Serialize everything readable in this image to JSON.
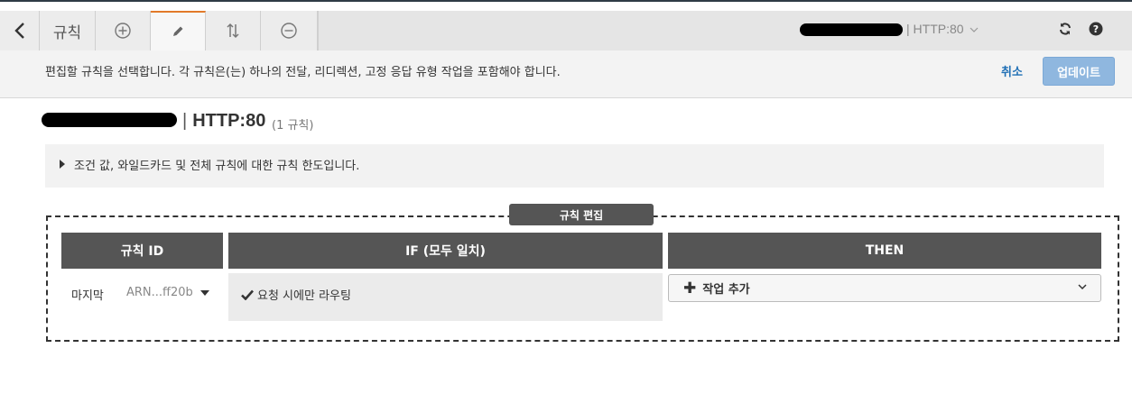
{
  "toolbar": {
    "tab_label": "규칙",
    "load_balancer_protocol": "| HTTP:80",
    "colors": {
      "active_accent": "#e27a2a"
    }
  },
  "infobar": {
    "message": "편집할 규칙을 선택합니다. 각 규칙은(는) 하나의 전달, 리디렉션, 고정 응답 유형 작업을 포함해야 합니다.",
    "cancel_label": "취소",
    "update_label": "업데이트"
  },
  "listener": {
    "title_suffix": "HTTP:80",
    "separator": "|",
    "rule_count": "(1 규칙)"
  },
  "conditions_toggle": {
    "label": "조건 값, 와일드카드 및 전체 규칙에 대한 규칙 한도입니다."
  },
  "edit_panel": {
    "label": "규칙 편집",
    "columns": [
      "규칙 ID",
      "IF (모두 일치)",
      "THEN"
    ],
    "row": {
      "rule_id": "마지막",
      "arn": "ARN...ff20b",
      "if_condition": "요청 시에만 라우팅",
      "then_action": "작업 추가"
    }
  }
}
